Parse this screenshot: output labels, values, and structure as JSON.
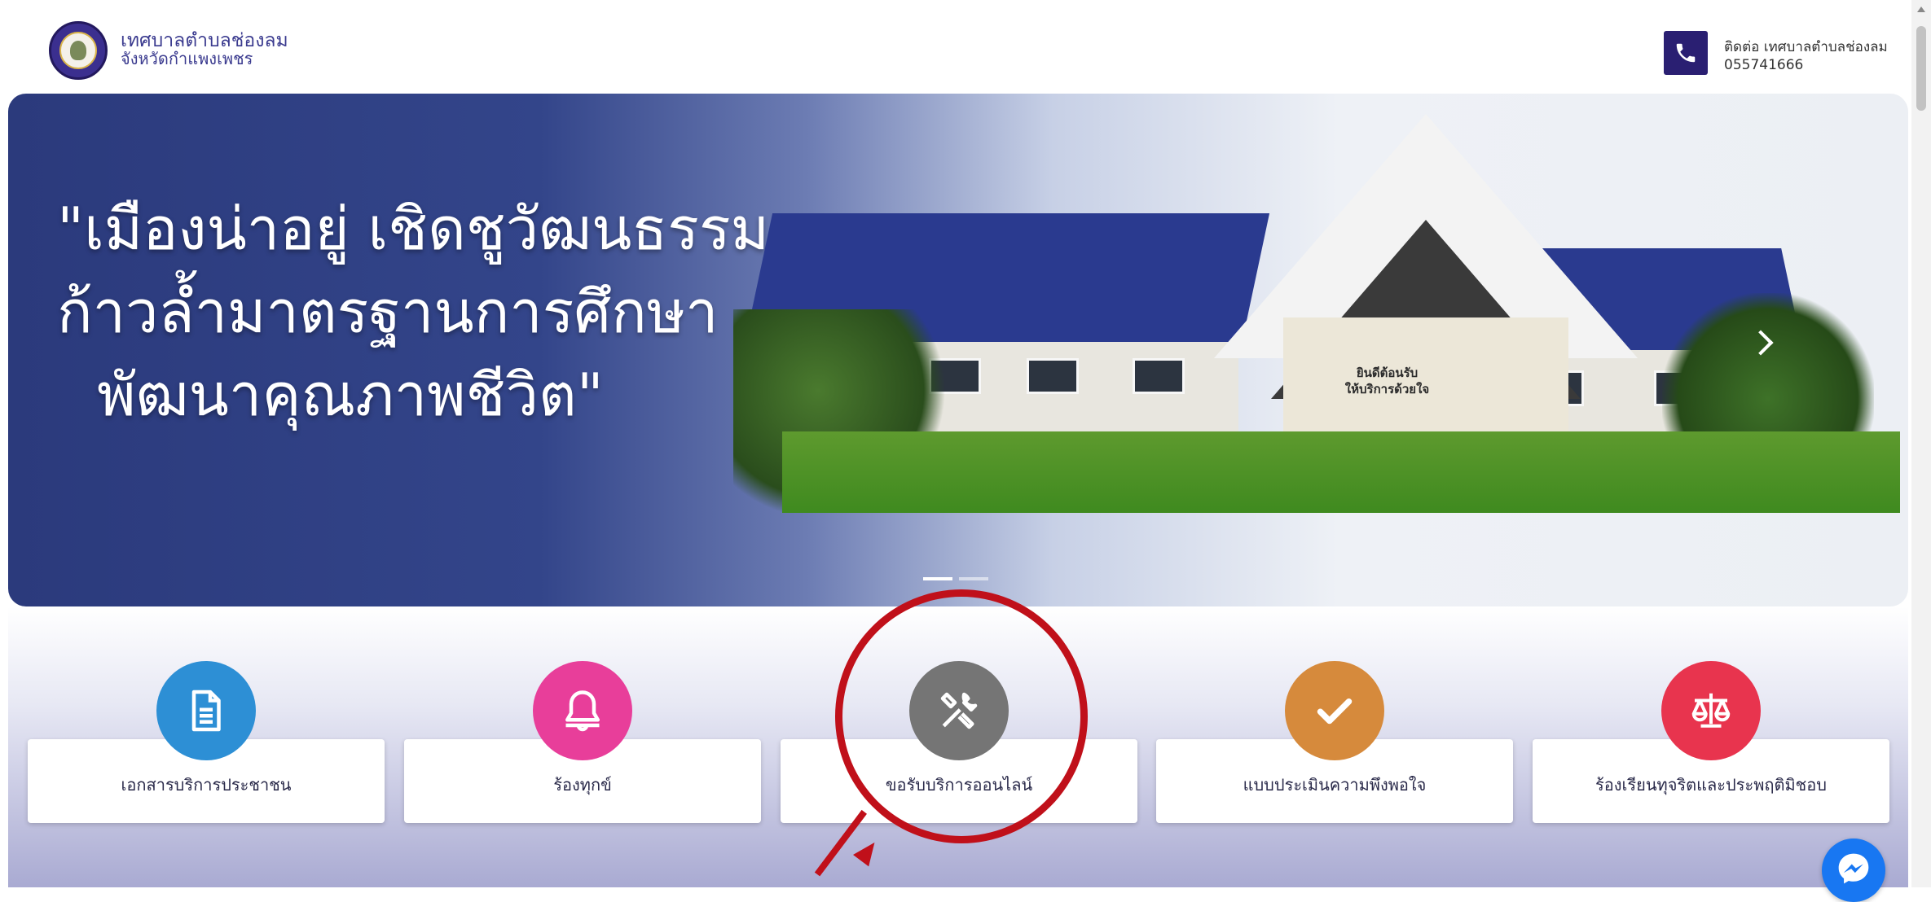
{
  "header": {
    "org_name": "เทศบาลตำบลช่องลม",
    "org_province": "จังหวัดกำแพงเพชร",
    "contact_label": "ติดต่อ เทศบาลตำบลช่องลม",
    "contact_phone": "055741666"
  },
  "hero": {
    "quote_lines": [
      "\"เมืองน่าอยู่ เชิดชูวัฒนธรรม",
      "ก้าวล้ำมาตรฐานการศึกษา",
      "พัฒนาคุณภาพชีวิต\""
    ],
    "sign_lines": [
      "ยินดีต้อนรับ",
      "ให้บริการด้วยใจ"
    ],
    "slide_count": 2,
    "active_slide": 1
  },
  "services": [
    {
      "label": "เอกสารบริการประชาชน",
      "icon": "document-icon",
      "color": "#2d8fd5"
    },
    {
      "label": "ร้องทุกข์",
      "icon": "bell-icon",
      "color": "#e83e9a"
    },
    {
      "label": "ขอรับบริการออนไลน์",
      "icon": "tools-icon",
      "color": "#757575"
    },
    {
      "label": "แบบประเมินความพึงพอใจ",
      "icon": "check-icon",
      "color": "#d68a3c"
    },
    {
      "label": "ร้องเรียนทุจริตและประพฤติมิชอบ",
      "icon": "scales-icon",
      "color": "#e8344e"
    }
  ],
  "colors": {
    "accent": "#2a1f72",
    "annotation": "#c0101a",
    "messenger": "#1877f2"
  },
  "icons": {
    "phone": "phone-icon",
    "messenger": "messenger-icon",
    "next": "chevron-right-icon"
  }
}
